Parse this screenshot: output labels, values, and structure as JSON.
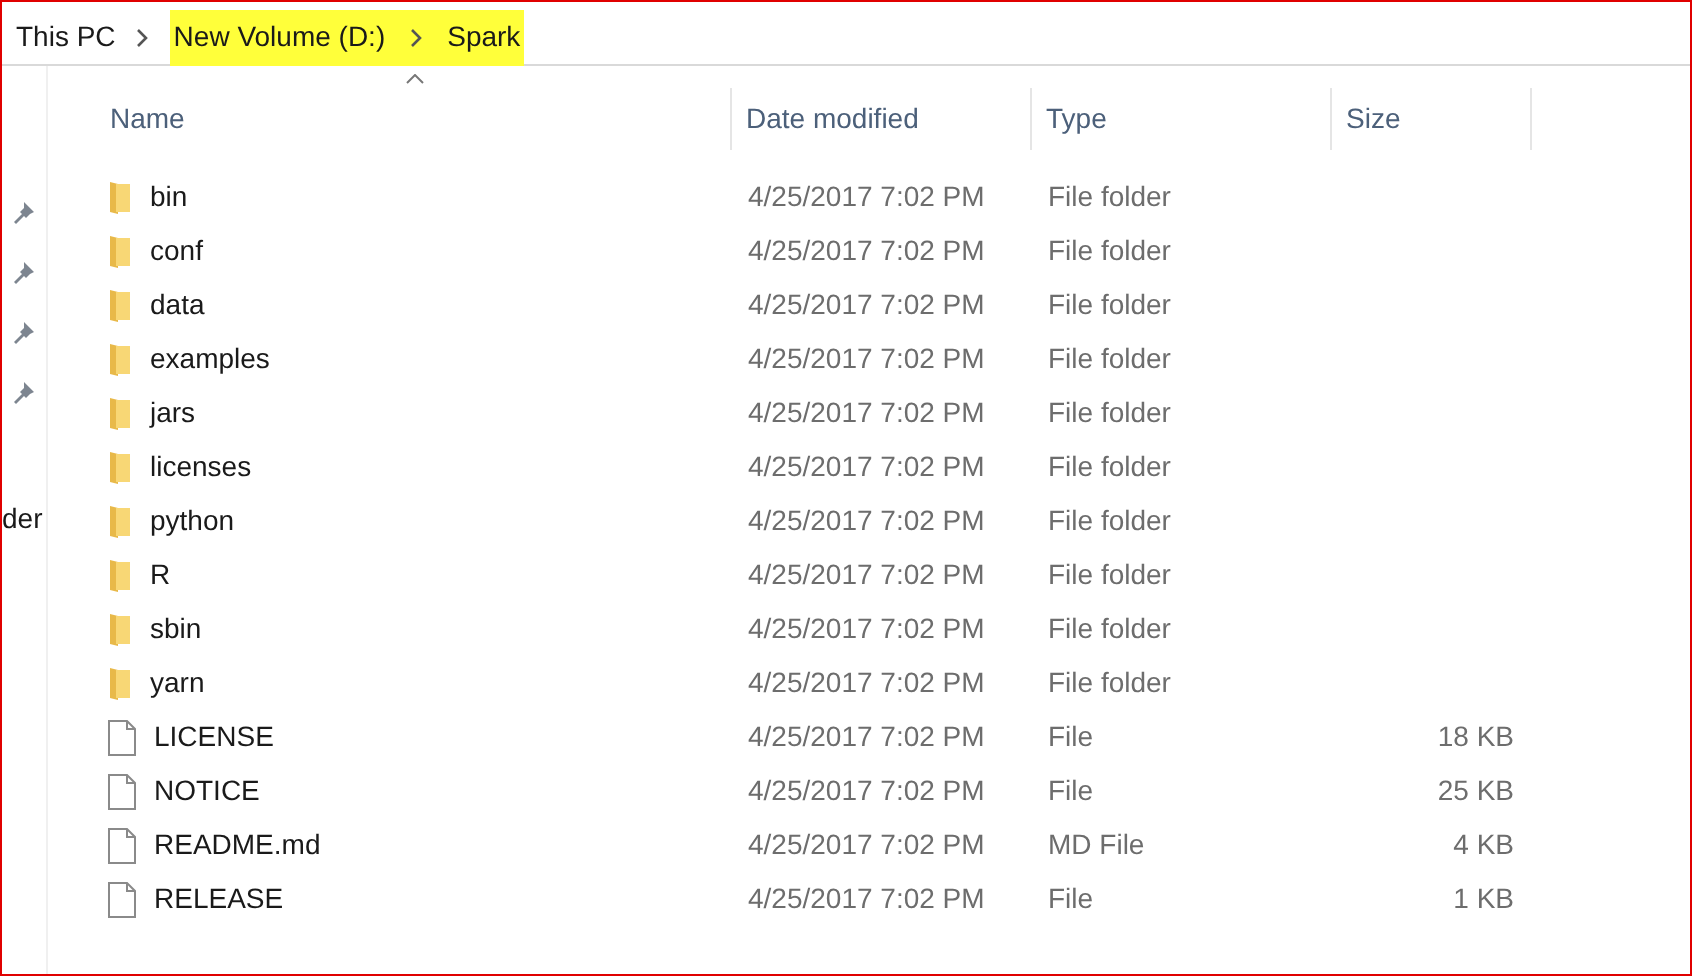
{
  "breadcrumb": [
    {
      "label": "This PC",
      "highlighted": false
    },
    {
      "label": "New Volume (D:)",
      "highlighted": true
    },
    {
      "label": "Spark",
      "highlighted": true
    }
  ],
  "navigation_pane": {
    "pinned_count_text": "der"
  },
  "table": {
    "columns": [
      {
        "label": "Name",
        "sorted": true
      },
      {
        "label": "Date modified",
        "sorted": false
      },
      {
        "label": "Type",
        "sorted": false
      },
      {
        "label": "Size",
        "sorted": false
      }
    ],
    "rows": [
      {
        "kind": "folder",
        "name": "bin",
        "date": "4/25/2017 7:02 PM",
        "type": "File folder"
      },
      {
        "kind": "folder",
        "name": "conf",
        "date": "4/25/2017 7:02 PM",
        "type": "File folder"
      },
      {
        "kind": "folder",
        "name": "data",
        "date": "4/25/2017 7:02 PM",
        "type": "File folder"
      },
      {
        "kind": "folder",
        "name": "examples",
        "date": "4/25/2017 7:02 PM",
        "type": "File folder"
      },
      {
        "kind": "folder",
        "name": "jars",
        "date": "4/25/2017 7:02 PM",
        "type": "File folder"
      },
      {
        "kind": "folder",
        "name": "licenses",
        "date": "4/25/2017 7:02 PM",
        "type": "File folder"
      },
      {
        "kind": "folder",
        "name": "python",
        "date": "4/25/2017 7:02 PM",
        "type": "File folder"
      },
      {
        "kind": "folder",
        "name": "R",
        "date": "4/25/2017 7:02 PM",
        "type": "File folder"
      },
      {
        "kind": "folder",
        "name": "sbin",
        "date": "4/25/2017 7:02 PM",
        "type": "File folder"
      },
      {
        "kind": "folder",
        "name": "yarn",
        "date": "4/25/2017 7:02 PM",
        "type": "File folder"
      },
      {
        "kind": "file",
        "name": "LICENSE",
        "date": "4/25/2017 7:02 PM",
        "type": "File",
        "size": "18 KB"
      },
      {
        "kind": "file",
        "name": "NOTICE",
        "date": "4/25/2017 7:02 PM",
        "type": "File",
        "size": "25 KB"
      },
      {
        "kind": "file",
        "name": "README.md",
        "date": "4/25/2017 7:02 PM",
        "type": "MD File",
        "size": "4 KB"
      },
      {
        "kind": "file",
        "name": "RELEASE",
        "date": "4/25/2017 7:02 PM",
        "type": "File",
        "size": "1 KB"
      }
    ]
  }
}
